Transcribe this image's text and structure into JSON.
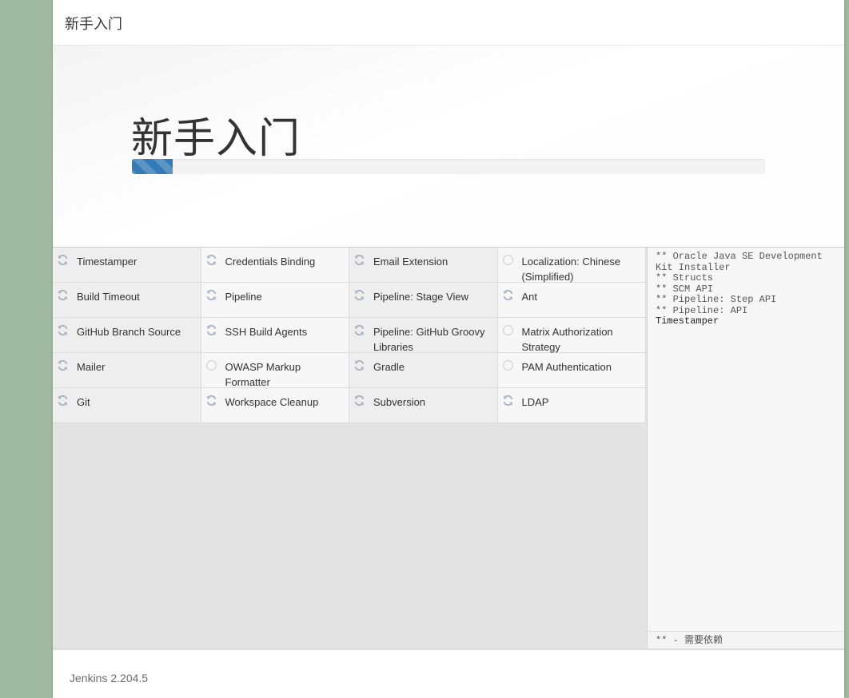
{
  "header": {
    "title": "新手入门"
  },
  "hero": {
    "title": "新手入门",
    "progress_fraction": 0.065
  },
  "colors": {
    "accent": "#337ab7",
    "pending_icon": "#cccccc",
    "background": "#9fbaa0"
  },
  "plugins": [
    {
      "name": "Timestamper",
      "status": "installing",
      "icon": "refresh-icon"
    },
    {
      "name": "Credentials Binding",
      "status": "installing",
      "icon": "refresh-icon"
    },
    {
      "name": "Email Extension",
      "status": "installing",
      "icon": "refresh-icon"
    },
    {
      "name": "Localization: Chinese (Simplified)",
      "status": "pending",
      "icon": "circle-icon"
    },
    {
      "name": "Build Timeout",
      "status": "installing",
      "icon": "refresh-icon"
    },
    {
      "name": "Pipeline",
      "status": "installing",
      "icon": "refresh-icon"
    },
    {
      "name": "Pipeline: Stage View",
      "status": "installing",
      "icon": "refresh-icon"
    },
    {
      "name": "Ant",
      "status": "installing",
      "icon": "refresh-icon"
    },
    {
      "name": "GitHub Branch Source",
      "status": "installing",
      "icon": "refresh-icon"
    },
    {
      "name": "SSH Build Agents",
      "status": "installing",
      "icon": "refresh-icon"
    },
    {
      "name": "Pipeline: GitHub Groovy Libraries",
      "status": "installing",
      "icon": "refresh-icon"
    },
    {
      "name": "Matrix Authorization Strategy",
      "status": "pending",
      "icon": "circle-icon"
    },
    {
      "name": "Mailer",
      "status": "installing",
      "icon": "refresh-icon"
    },
    {
      "name": "OWASP Markup Formatter",
      "status": "pending",
      "icon": "circle-icon"
    },
    {
      "name": "Gradle",
      "status": "installing",
      "icon": "refresh-icon"
    },
    {
      "name": "PAM Authentication",
      "status": "pending",
      "icon": "circle-icon"
    },
    {
      "name": "Git",
      "status": "installing",
      "icon": "refresh-icon"
    },
    {
      "name": "Workspace Cleanup",
      "status": "installing",
      "icon": "refresh-icon"
    },
    {
      "name": "Subversion",
      "status": "installing",
      "icon": "refresh-icon"
    },
    {
      "name": "LDAP",
      "status": "installing",
      "icon": "refresh-icon"
    }
  ],
  "log": {
    "lines": [
      "** Oracle Java SE Development Kit Installer",
      "** Structs",
      "** SCM API",
      "** Pipeline: Step API",
      "** Pipeline: API"
    ],
    "current": "Timestamper",
    "legend": "** - 需要依赖"
  },
  "footer": {
    "version": "Jenkins 2.204.5"
  }
}
